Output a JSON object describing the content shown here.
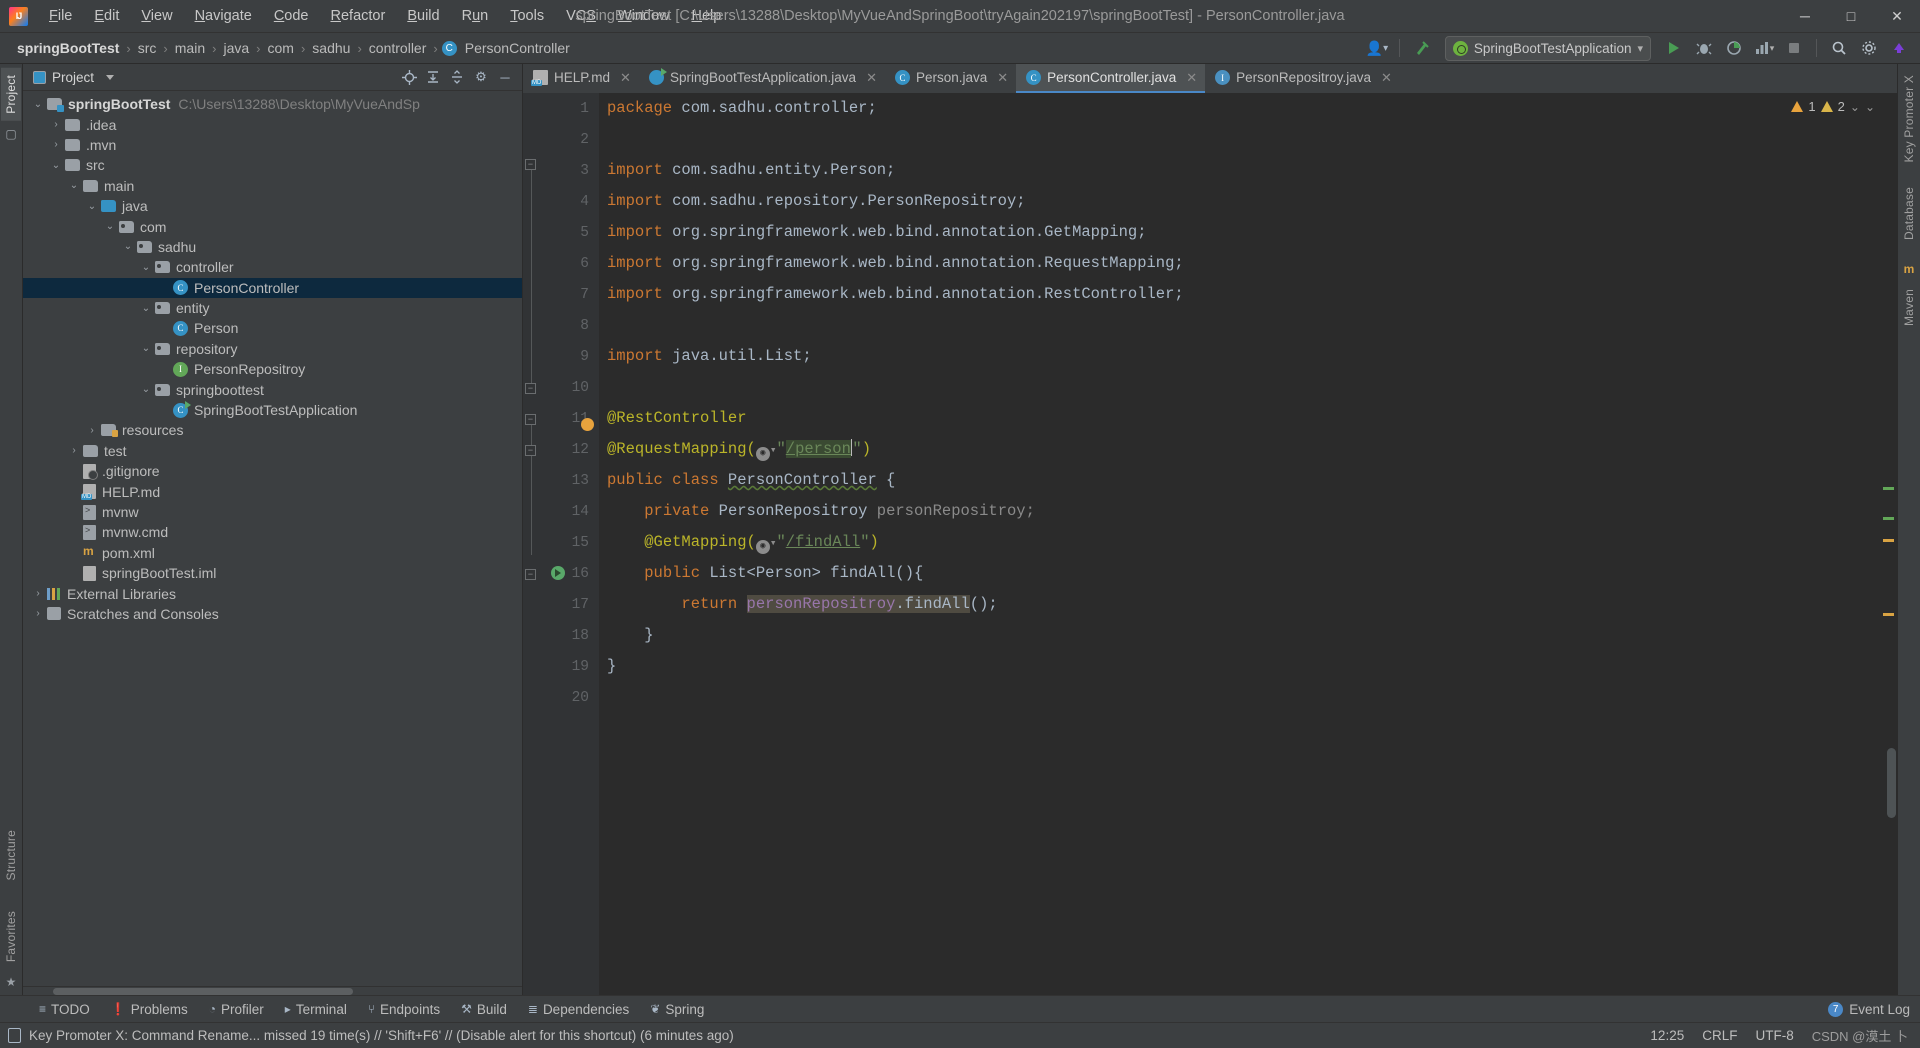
{
  "window": {
    "title": "springBootTest [C:\\Users\\13288\\Desktop\\MyVueAndSpringBoot\\tryAgain202197\\springBootTest] - PersonController.java",
    "minimize_label": "─",
    "maximize_label": "□",
    "close_label": "✕"
  },
  "menubar": {
    "items": [
      {
        "label": "File",
        "mnemonic": "F"
      },
      {
        "label": "Edit",
        "mnemonic": "E"
      },
      {
        "label": "View",
        "mnemonic": "V"
      },
      {
        "label": "Navigate",
        "mnemonic": "N"
      },
      {
        "label": "Code",
        "mnemonic": "C"
      },
      {
        "label": "Refactor",
        "mnemonic": "R"
      },
      {
        "label": "Build",
        "mnemonic": "B"
      },
      {
        "label": "Run",
        "mnemonic": "u"
      },
      {
        "label": "Tools",
        "mnemonic": "T"
      },
      {
        "label": "VCS",
        "mnemonic": "S"
      },
      {
        "label": "Window",
        "mnemonic": "W"
      },
      {
        "label": "Help",
        "mnemonic": "H"
      }
    ]
  },
  "navbar": {
    "breadcrumbs": [
      "springBootTest",
      "src",
      "main",
      "java",
      "com",
      "sadhu",
      "controller",
      "PersonController"
    ],
    "class_icon_letter": "C",
    "run_config": "SpringBootTestApplication",
    "run_config_caret": "▾",
    "icons": {
      "user": "user-icon",
      "hammer": "build-hammer-icon",
      "run": "run-icon",
      "debug": "debug-icon",
      "coverage": "coverage-icon",
      "profile": "profile-icon",
      "stop": "stop-icon",
      "search": "search-icon",
      "settings": "settings-icon",
      "updates": "updates-icon"
    }
  },
  "left_rail": {
    "tabs": [
      "Project",
      "Structure",
      "Favorites"
    ],
    "active": "Project"
  },
  "right_rail": {
    "tabs": [
      "Key Promoter X",
      "Database",
      "Maven"
    ]
  },
  "project_panel": {
    "title": "Project",
    "caret": "▾",
    "header_icons": [
      "locate-icon",
      "expand-all-icon",
      "collapse-all-icon",
      "settings-icon",
      "hide-icon"
    ],
    "tree": [
      {
        "label": "springBootTest",
        "path": "C:\\Users\\13288\\Desktop\\MyVueAndSp",
        "depth": 0,
        "arrow": "⌄",
        "icon": "folder-project",
        "bold": true,
        "selected": false
      },
      {
        "label": ".idea",
        "path": "",
        "depth": 1,
        "arrow": "›",
        "icon": "folder",
        "bold": false,
        "selected": false
      },
      {
        "label": ".mvn",
        "path": "",
        "depth": 1,
        "arrow": "›",
        "icon": "folder",
        "bold": false,
        "selected": false
      },
      {
        "label": "src",
        "path": "",
        "depth": 1,
        "arrow": "⌄",
        "icon": "folder",
        "bold": false,
        "selected": false
      },
      {
        "label": "main",
        "path": "",
        "depth": 2,
        "arrow": "⌄",
        "icon": "folder",
        "bold": false,
        "selected": false
      },
      {
        "label": "java",
        "path": "",
        "depth": 3,
        "arrow": "⌄",
        "icon": "folder-source",
        "bold": false,
        "selected": false
      },
      {
        "label": "com",
        "path": "",
        "depth": 4,
        "arrow": "⌄",
        "icon": "folder-package",
        "bold": false,
        "selected": false
      },
      {
        "label": "sadhu",
        "path": "",
        "depth": 5,
        "arrow": "⌄",
        "icon": "folder-package",
        "bold": false,
        "selected": false
      },
      {
        "label": "controller",
        "path": "",
        "depth": 6,
        "arrow": "⌄",
        "icon": "folder-package",
        "bold": false,
        "selected": false
      },
      {
        "label": "PersonController",
        "path": "",
        "depth": 7,
        "arrow": "",
        "icon": "class",
        "bold": false,
        "selected": true
      },
      {
        "label": "entity",
        "path": "",
        "depth": 6,
        "arrow": "⌄",
        "icon": "folder-package",
        "bold": false,
        "selected": false
      },
      {
        "label": "Person",
        "path": "",
        "depth": 7,
        "arrow": "",
        "icon": "class",
        "bold": false,
        "selected": false
      },
      {
        "label": "repository",
        "path": "",
        "depth": 6,
        "arrow": "⌄",
        "icon": "folder-package",
        "bold": false,
        "selected": false
      },
      {
        "label": "PersonRepositroy",
        "path": "",
        "depth": 7,
        "arrow": "",
        "icon": "interface",
        "bold": false,
        "selected": false
      },
      {
        "label": "springboottest",
        "path": "",
        "depth": 6,
        "arrow": "⌄",
        "icon": "folder-package",
        "bold": false,
        "selected": false
      },
      {
        "label": "SpringBootTestApplication",
        "path": "",
        "depth": 7,
        "arrow": "",
        "icon": "class-runnable",
        "bold": false,
        "selected": false
      },
      {
        "label": "resources",
        "path": "",
        "depth": 3,
        "arrow": "›",
        "icon": "folder-resources",
        "bold": false,
        "selected": false
      },
      {
        "label": "test",
        "path": "",
        "depth": 2,
        "arrow": "›",
        "icon": "folder",
        "bold": false,
        "selected": false
      },
      {
        "label": ".gitignore",
        "path": "",
        "depth": 2,
        "arrow": "",
        "icon": "file-gitignore",
        "bold": false,
        "selected": false
      },
      {
        "label": "HELP.md",
        "path": "",
        "depth": 2,
        "arrow": "",
        "icon": "file-md",
        "bold": false,
        "selected": false
      },
      {
        "label": "mvnw",
        "path": "",
        "depth": 2,
        "arrow": "",
        "icon": "file-cmd",
        "bold": false,
        "selected": false
      },
      {
        "label": "mvnw.cmd",
        "path": "",
        "depth": 2,
        "arrow": "",
        "icon": "file-cmd",
        "bold": false,
        "selected": false
      },
      {
        "label": "pom.xml",
        "path": "",
        "depth": 2,
        "arrow": "",
        "icon": "file-maven",
        "bold": false,
        "selected": false
      },
      {
        "label": "springBootTest.iml",
        "path": "",
        "depth": 2,
        "arrow": "",
        "icon": "file-iml",
        "bold": false,
        "selected": false
      },
      {
        "label": "External Libraries",
        "path": "",
        "depth": 0,
        "arrow": "›",
        "icon": "libraries",
        "bold": false,
        "selected": false
      },
      {
        "label": "Scratches and Consoles",
        "path": "",
        "depth": 0,
        "arrow": "›",
        "icon": "scratches",
        "bold": false,
        "selected": false
      }
    ]
  },
  "editor_tabs": [
    {
      "label": "HELP.md",
      "icon": "md",
      "active": false,
      "close": "✕"
    },
    {
      "label": "SpringBootTestApplication.java",
      "icon": "spring",
      "active": false,
      "close": "✕"
    },
    {
      "label": "Person.java",
      "icon": "class",
      "active": false,
      "close": "✕"
    },
    {
      "label": "PersonController.java",
      "icon": "class",
      "active": true,
      "close": "✕"
    },
    {
      "label": "PersonRepositroy.java",
      "icon": "interface",
      "active": false,
      "close": "✕"
    }
  ],
  "editor": {
    "line_numbers": [
      1,
      2,
      3,
      4,
      5,
      6,
      7,
      8,
      9,
      10,
      11,
      12,
      13,
      14,
      15,
      16,
      17,
      18,
      19,
      20
    ],
    "warnings_count": "1",
    "weak_warnings_count": "2",
    "hud_caret": "⌄",
    "hud_collapse": "⌄",
    "code_lines": [
      {
        "n": 1,
        "text": "package com.sadhu.controller;"
      },
      {
        "n": 2,
        "text": ""
      },
      {
        "n": 3,
        "text": "import com.sadhu.entity.Person;"
      },
      {
        "n": 4,
        "text": "import com.sadhu.repository.PersonRepositroy;"
      },
      {
        "n": 5,
        "text": "import org.springframework.web.bind.annotation.GetMapping;"
      },
      {
        "n": 6,
        "text": "import org.springframework.web.bind.annotation.RequestMapping;"
      },
      {
        "n": 7,
        "text": "import org.springframework.web.bind.annotation.RestController;"
      },
      {
        "n": 8,
        "text": ""
      },
      {
        "n": 9,
        "text": "import java.util.List;"
      },
      {
        "n": 10,
        "text": ""
      },
      {
        "n": 11,
        "text": "@RestController"
      },
      {
        "n": 12,
        "text": "@RequestMapping(\"/person\")"
      },
      {
        "n": 13,
        "text": "public class PersonController {"
      },
      {
        "n": 14,
        "text": "    private PersonRepositroy personRepositroy;"
      },
      {
        "n": 15,
        "text": "    @GetMapping(\"/findAll\")"
      },
      {
        "n": 16,
        "text": "    public List<Person> findAll(){"
      },
      {
        "n": 17,
        "text": "        return personRepositroy.findAll();"
      },
      {
        "n": 18,
        "text": "    }"
      },
      {
        "n": 19,
        "text": "}"
      },
      {
        "n": 20,
        "text": ""
      }
    ],
    "tokens": {
      "kw_package": "package",
      "kw_import": "import",
      "kw_public": "public",
      "kw_class": "class",
      "kw_private": "private",
      "kw_return": "return",
      "pkg_controller": " com.sadhu.controller;",
      "imp3": " com.sadhu.entity.Person;",
      "imp4": " com.sadhu.repository.PersonRepositroy;",
      "imp5": " org.springframework.web.bind.annotation.GetMapping;",
      "imp6": " org.springframework.web.bind.annotation.RequestMapping;",
      "imp7": " org.springframework.web.bind.annotation.RestController;",
      "imp9": " java.util.List;",
      "anno_rest": "@RestController",
      "anno_reqmap_open": "@RequestMapping(",
      "anno_getmap_open": "@GetMapping(",
      "quote": "\"",
      "url_person": "/person",
      "url_findall": "/findAll",
      "close_paren": ")",
      "class_name": "PersonController",
      "brace_open": " {",
      "field_type": " PersonRepositroy ",
      "field_name": "personRepositroy;",
      "method_sig": " List<Person> findAll(){",
      "ret_obj": "personRepositroy",
      "ret_call": ".findAll();",
      "brace_close_inner": "}",
      "brace_close_outer": "}",
      "globe_icon": "♁",
      "globe_caret": "⌄"
    }
  },
  "bottom_tabs": [
    {
      "label": "TODO",
      "icon": "list-icon"
    },
    {
      "label": "Problems",
      "icon": "exclamation-icon"
    },
    {
      "label": "Profiler",
      "icon": "profiler-icon"
    },
    {
      "label": "Terminal",
      "icon": "terminal-icon"
    },
    {
      "label": "Endpoints",
      "icon": "endpoints-icon"
    },
    {
      "label": "Build",
      "icon": "hammer-icon"
    },
    {
      "label": "Dependencies",
      "icon": "dependencies-icon"
    },
    {
      "label": "Spring",
      "icon": "spring-leaf-icon"
    }
  ],
  "bottom_right": {
    "event_log": "Event Log",
    "event_icon_letter": "7"
  },
  "statusbar": {
    "message": "Key Promoter X: Command Rename... missed 19 time(s) // 'Shift+F6' // (Disable alert for this shortcut) (6 minutes ago)",
    "time": "12:25",
    "line_sep": "CRLF",
    "encoding": "UTF-8",
    "watermark": "CSDN @漠土 卜"
  },
  "colors": {
    "accent": "#3592c4",
    "run_green": "#59a869",
    "keyword": "#cc7832",
    "string": "#6a8759",
    "annotation": "#bbb529",
    "field": "#9876aa",
    "bg_editor": "#2b2b2b",
    "bg_chrome": "#3c3f41",
    "selection": "#0d293e"
  }
}
